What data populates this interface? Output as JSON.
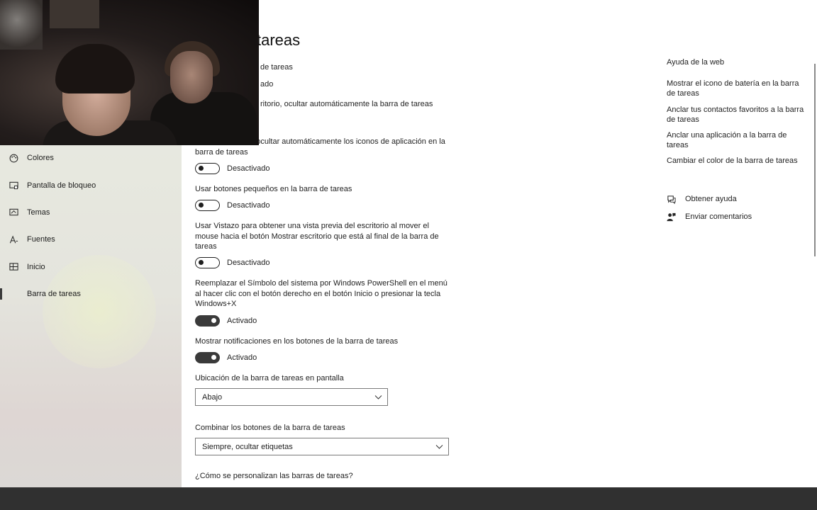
{
  "window": {
    "controls": [
      "minimize-icon",
      "restore-icon",
      "close-icon"
    ]
  },
  "sidebar": {
    "items": [
      {
        "label": "Colores",
        "icon": "palette-icon"
      },
      {
        "label": "Pantalla de bloqueo",
        "icon": "lock-screen-icon"
      },
      {
        "label": "Temas",
        "icon": "themes-icon"
      },
      {
        "label": "Fuentes",
        "icon": "fonts-icon"
      },
      {
        "label": "Inicio",
        "icon": "start-icon"
      },
      {
        "label": "Barra de tareas",
        "icon": "taskbar-icon",
        "active": true
      }
    ]
  },
  "main": {
    "title_visible": "tareas",
    "partial_lines": [
      "de tareas",
      "ado",
      "ritorio, ocultar automáticamente la barra de tareas"
    ],
    "settings": [
      {
        "label": "a, ocultar automáticamente los iconos de aplicación en la barra de tareas",
        "state": "Desactivado",
        "on": false
      },
      {
        "label": "Usar botones pequeños en la barra de tareas",
        "state": "Desactivado",
        "on": false
      },
      {
        "label": "Usar Vistazo para obtener una vista previa del escritorio al mover el mouse hacia el botón Mostrar escritorio que está al final de la barra de tareas",
        "state": "Desactivado",
        "on": false
      },
      {
        "label": "Reemplazar el Símbolo del sistema por Windows PowerShell en el menú al hacer clic con el botón derecho en el botón Inicio o presionar la tecla Windows+X",
        "state": "Activado",
        "on": true
      },
      {
        "label": "Mostrar notificaciones en los botones de la barra de tareas",
        "state": "Activado",
        "on": true
      }
    ],
    "location": {
      "label": "Ubicación de la barra de tareas en pantalla",
      "value": "Abajo"
    },
    "combine": {
      "label": "Combinar los botones de la barra de tareas",
      "value": "Siempre, ocultar etiquetas"
    },
    "help_link": "¿Cómo se personalizan las barras de tareas?"
  },
  "right": {
    "title": "Ayuda de la web",
    "links": [
      "Mostrar el icono de batería en la barra de tareas",
      "Anclar tus contactos favoritos a la barra de tareas",
      "Anclar una aplicación a la barra de tareas",
      "Cambiar el color de la barra de tareas"
    ],
    "help": {
      "label": "Obtener ayuda",
      "icon": "help-chat-icon"
    },
    "feedback": {
      "label": "Enviar comentarios",
      "icon": "feedback-icon"
    }
  },
  "colors": {
    "toggle_on": "#3a3a3a",
    "taskbar": "#303030",
    "text": "#1f1f1f"
  }
}
